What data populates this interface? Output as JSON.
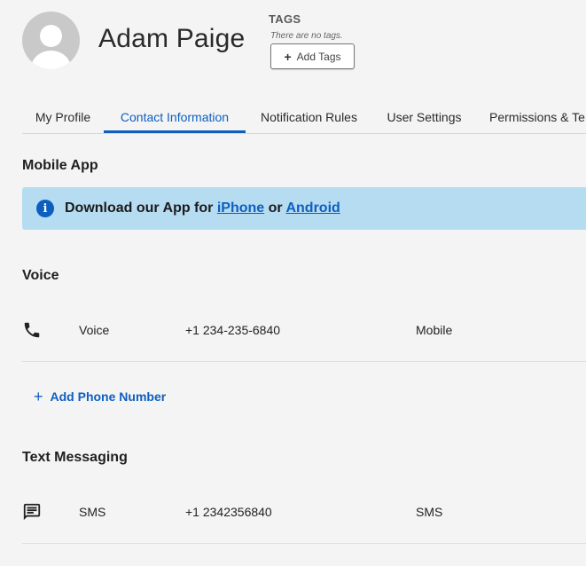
{
  "header": {
    "user_name": "Adam Paige",
    "tags_label": "TAGS",
    "tags_empty": "There are no tags.",
    "add_tags_label": "Add Tags"
  },
  "tabs": [
    {
      "label": "My Profile",
      "active": false
    },
    {
      "label": "Contact Information",
      "active": true
    },
    {
      "label": "Notification Rules",
      "active": false
    },
    {
      "label": "User Settings",
      "active": false
    },
    {
      "label": "Permissions & Te",
      "active": false
    }
  ],
  "mobile_app": {
    "title": "Mobile App",
    "banner": {
      "prefix": "Download our App for ",
      "iphone_link": "iPhone",
      "middle": " or ",
      "android_link": "Android"
    }
  },
  "voice": {
    "title": "Voice",
    "entries": [
      {
        "type": "Voice",
        "number": "+1 234-235-6840",
        "label": "Mobile",
        "icon": "phone-icon"
      }
    ],
    "add_label": "Add Phone Number"
  },
  "text_messaging": {
    "title": "Text Messaging",
    "entries": [
      {
        "type": "SMS",
        "number": "+1 2342356840",
        "label": "SMS",
        "icon": "message-icon"
      }
    ]
  },
  "colors": {
    "accent": "#0d5fbf",
    "banner_bg": "#b6dcf2",
    "page_bg": "#f4f4f4"
  }
}
